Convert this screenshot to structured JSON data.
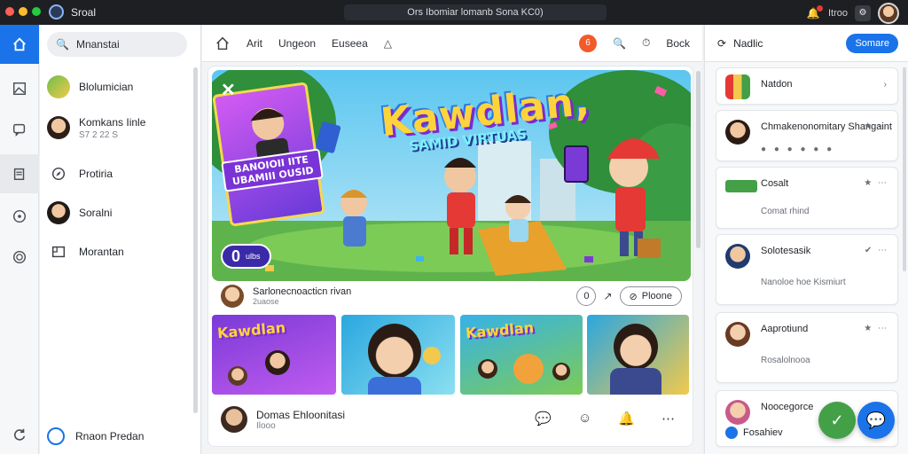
{
  "window": {
    "app_name": "Sroal",
    "title": "Ors Ibomiar lomanb Sona KC0)",
    "user_label": "Itroo",
    "traffic_lights": [
      "#ff5f57",
      "#febc2e",
      "#28c840"
    ]
  },
  "rail": {
    "items": [
      "home-icon",
      "gallery-icon",
      "chat-icon",
      "files-icon",
      "help-icon",
      "sync-icon",
      "refresh-icon"
    ]
  },
  "channels": {
    "search_text": "Mnanstai",
    "items": [
      {
        "name": "Blolumician",
        "sub": "",
        "kind": "image"
      },
      {
        "name": "Komkans Iinle",
        "sub": "S7 2 22 S",
        "kind": "avatar"
      },
      {
        "name": "Protiria",
        "sub": "",
        "kind": "icon"
      },
      {
        "name": "Soralni",
        "sub": "",
        "kind": "avatar"
      },
      {
        "name": "Morantan",
        "sub": "",
        "kind": "icon"
      }
    ],
    "footer_label": "Rnaon Predan"
  },
  "toolbar": {
    "items": [
      "Arit",
      "Ungeon",
      "Euseea"
    ],
    "back_label": "Bock",
    "notif_count": "6"
  },
  "post": {
    "hero_title": "Kawdlan,",
    "hero_subtitle": "SAMID VIRTUAS",
    "poster_text": "BANOIOII IITE UBAMIII OUSID",
    "hero_pill_big": "0",
    "hero_pill_small": "ulbs",
    "author": "Sarlonecnoacticn rivan",
    "time": "2uaose",
    "count_label": "0",
    "action_label": "Ploone",
    "thumb_titles": [
      "Kawdlan",
      "",
      "Kawdlan",
      ""
    ],
    "footer_author": "Domas Ehloonitasi",
    "footer_time": "Ilooo"
  },
  "right_panel": {
    "title": "Nadlic",
    "button_label": "Somare",
    "cards": [
      {
        "title": "Natdon",
        "sub": ""
      },
      {
        "title": "Chmakenonomitary Shangaint",
        "sub": ""
      },
      {
        "title": "Cosalt",
        "sub": "Comat rhind"
      },
      {
        "title": "Solotesasik",
        "sub": "Nanoloe hoe Kismiurt"
      },
      {
        "title": "Aaprotiund",
        "sub": "Rosalolnooa"
      },
      {
        "title": "Noocegorce",
        "sub": ""
      }
    ],
    "bottom_label": "Fosahiev"
  }
}
